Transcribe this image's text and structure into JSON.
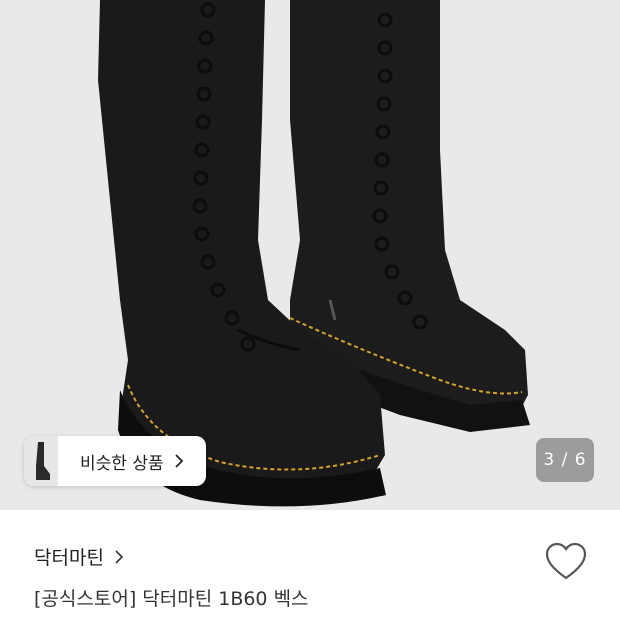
{
  "gallery": {
    "counter": "3 / 6"
  },
  "similar": {
    "label": "비슷한 상품"
  },
  "product": {
    "brand": "닥터마틴",
    "title": "[공식스토어] 닥터마틴 1B60 벡스"
  },
  "icons": {
    "similar_chevron": "chevron-right-icon",
    "brand_chevron": "chevron-right-icon",
    "wishlist": "heart-outline-icon"
  },
  "colors": {
    "photo_bg": "#e9e9eb",
    "leather": "#1a1a1b",
    "stitch": "#d9a520"
  }
}
